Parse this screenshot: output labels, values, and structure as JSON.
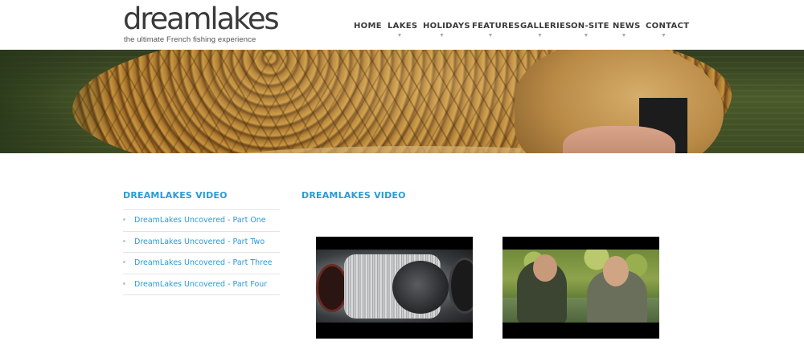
{
  "site": {
    "logo_word": "dreamlakes",
    "logo_tagline": "the ultimate French fishing experience"
  },
  "nav": {
    "items": [
      {
        "label": "HOME"
      },
      {
        "label": "LAKES"
      },
      {
        "label": "HOLIDAYS"
      },
      {
        "label": "FEATURES"
      },
      {
        "label": "GALLERIES"
      },
      {
        "label": "ON-SITE"
      },
      {
        "label": "NEWS"
      },
      {
        "label": "CONTACT"
      }
    ],
    "dropdown_arrow": "▼"
  },
  "sidebar": {
    "heading": "DREAMLAKES VIDEO",
    "items": [
      {
        "label": "DreamLakes Uncovered - Part One"
      },
      {
        "label": "DreamLakes Uncovered - Part Two"
      },
      {
        "label": "DreamLakes Uncovered - Part Three"
      },
      {
        "label": "DreamLakes Uncovered - Part Four"
      }
    ]
  },
  "main": {
    "heading": "DREAMLAKES VIDEO",
    "videos": [
      {
        "thumbnail": "fishing-reel-closeup"
      },
      {
        "thumbnail": "two-anglers-by-lake"
      }
    ]
  },
  "colors": {
    "accent": "#2b9ad6",
    "nav_text": "#3a3a3a",
    "divider": "#e4e4e4"
  }
}
